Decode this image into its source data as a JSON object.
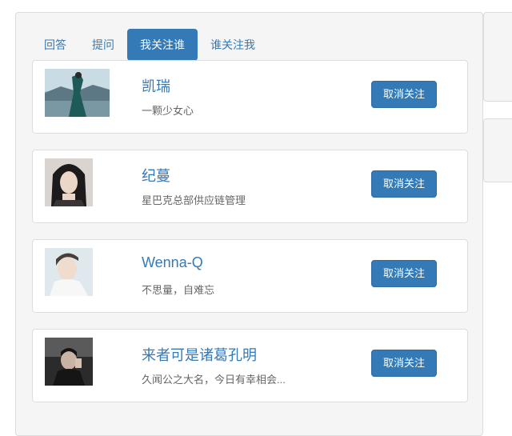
{
  "tabs": [
    {
      "label": "回答",
      "active": false
    },
    {
      "label": "提问",
      "active": false
    },
    {
      "label": "我关注谁",
      "active": true
    },
    {
      "label": "谁关注我",
      "active": false
    }
  ],
  "follow_list": [
    {
      "name": "凯瑞",
      "bio": "一颗少女心",
      "button": "取消关注",
      "avatar": "avatar-photo-lake"
    },
    {
      "name": "纪蔓",
      "bio": "星巴克总部供应链管理",
      "button": "取消关注",
      "avatar": "avatar-photo-girl"
    },
    {
      "name": "Wenna-Q",
      "bio": "不思量，自难忘",
      "button": "取消关注",
      "avatar": "avatar-photo-boy"
    },
    {
      "name": "来者可是诸葛孔明",
      "bio": "久闻公之大名，今日有幸相会...",
      "button": "取消关注",
      "avatar": "avatar-photo-dark"
    }
  ],
  "colors": {
    "accent": "#337ab7",
    "panel_bg": "#f5f5f5",
    "card_border": "#dddddd"
  }
}
